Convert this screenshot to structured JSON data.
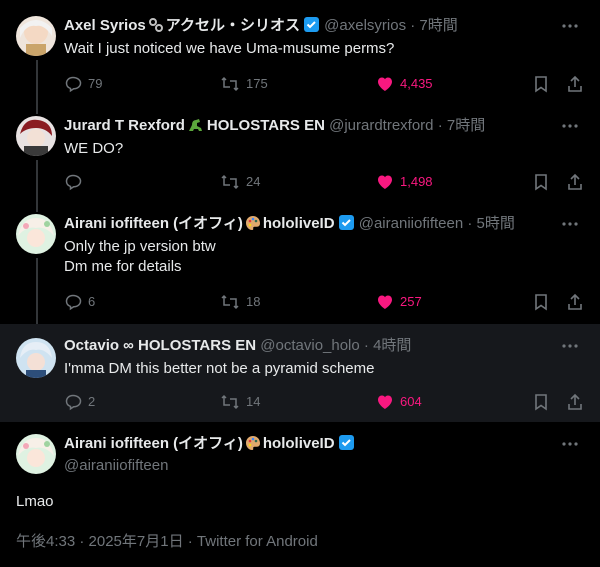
{
  "tweets": [
    {
      "display_name": "Axel Syrios",
      "emoji": "chain-link-emoji",
      "display_name_suffix": "アクセル・シリオス",
      "handle": "@axelsyrios",
      "time": "· 7時間",
      "text": "Wait I just noticed we have Uma-musume perms?",
      "replies": "79",
      "retweets": "175",
      "likes": "4,435",
      "verified": true
    },
    {
      "display_name": "Jurard T Rexford",
      "emoji": "dinosaur-emoji",
      "display_name_suffix": "HOLOSTARS EN",
      "handle": "@jurardtrexford",
      "time": "· 7時間",
      "text": "WE DO?",
      "replies": "",
      "retweets": "24",
      "likes": "1,498",
      "verified": false
    },
    {
      "display_name": "Airani iofifteen (イオフィ)",
      "emoji": "palette-emoji",
      "display_name_suffix": "hololiveID",
      "handle": "@airaniiofifteen",
      "time": "· 5時間",
      "text_lines": [
        "Only the jp version btw",
        "Dm me for details"
      ],
      "replies": "6",
      "retweets": "18",
      "likes": "257",
      "verified": true
    },
    {
      "display_name": "Octavio ∞ HOLOSTARS EN",
      "handle": "@octavio_holo",
      "time": "· 4時間",
      "text": "I'mma DM this better not be a pyramid scheme",
      "replies": "2",
      "retweets": "14",
      "likes": "604",
      "verified": false
    }
  ],
  "main": {
    "display_name": "Airani iofifteen (イオフィ)",
    "emoji": "palette-emoji",
    "display_name_suffix": "hololiveID",
    "handle": "@airaniiofifteen",
    "text": "Lmao",
    "meta": "午後4:33 · 2025年7月1日 · Twitter for Android",
    "verified": true
  },
  "colors": {
    "background": "#000000",
    "highlight_row": "#16181c",
    "text": "#e7e9ea",
    "muted": "#71767b",
    "like": "#f91880",
    "verified": "#1d9bf0",
    "thread_line": "#333639"
  },
  "icons": [
    "reply-icon",
    "retweet-icon",
    "heart-icon",
    "bookmark-icon",
    "share-icon",
    "more-icon",
    "verified-badge-icon"
  ]
}
